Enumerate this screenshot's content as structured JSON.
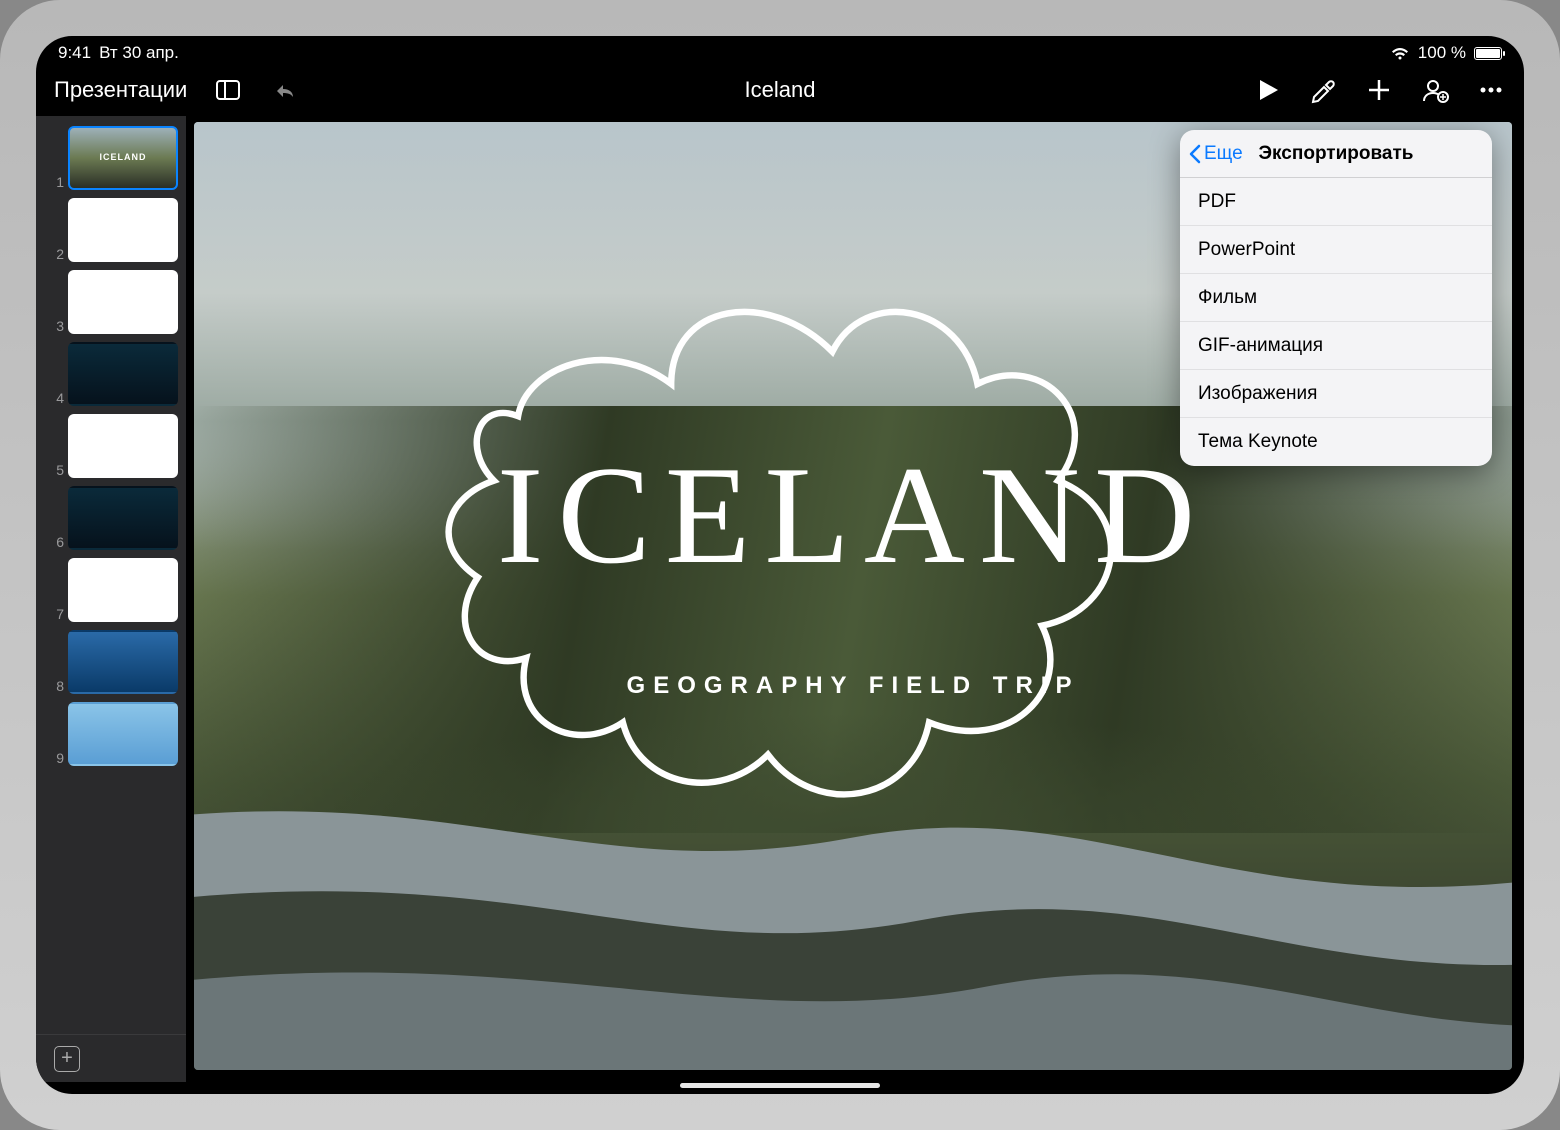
{
  "status": {
    "time": "9:41",
    "date": "Вт 30 апр.",
    "battery_text": "100 %"
  },
  "toolbar": {
    "documents_label": "Презентации",
    "doc_title": "Iceland"
  },
  "popover": {
    "back_label": "Еще",
    "title": "Экспортировать",
    "items": [
      "PDF",
      "PowerPoint",
      "Фильм",
      "GIF-анимация",
      "Изображения",
      "Тема Keynote"
    ]
  },
  "slide": {
    "title": "ICELAND",
    "subtitle": "GEOGRAPHY FIELD TRIP"
  },
  "thumbs": [
    {
      "n": "1",
      "selected": true,
      "bg": "landscape",
      "label": "ICELAND"
    },
    {
      "n": "2",
      "selected": false,
      "bg": "white"
    },
    {
      "n": "3",
      "selected": false,
      "bg": "white"
    },
    {
      "n": "4",
      "selected": false,
      "bg": "dark"
    },
    {
      "n": "5",
      "selected": false,
      "bg": "white"
    },
    {
      "n": "6",
      "selected": false,
      "bg": "dark"
    },
    {
      "n": "7",
      "selected": false,
      "bg": "white"
    },
    {
      "n": "8",
      "selected": false,
      "bg": "blue"
    },
    {
      "n": "9",
      "selected": false,
      "bg": "lightblue"
    }
  ]
}
